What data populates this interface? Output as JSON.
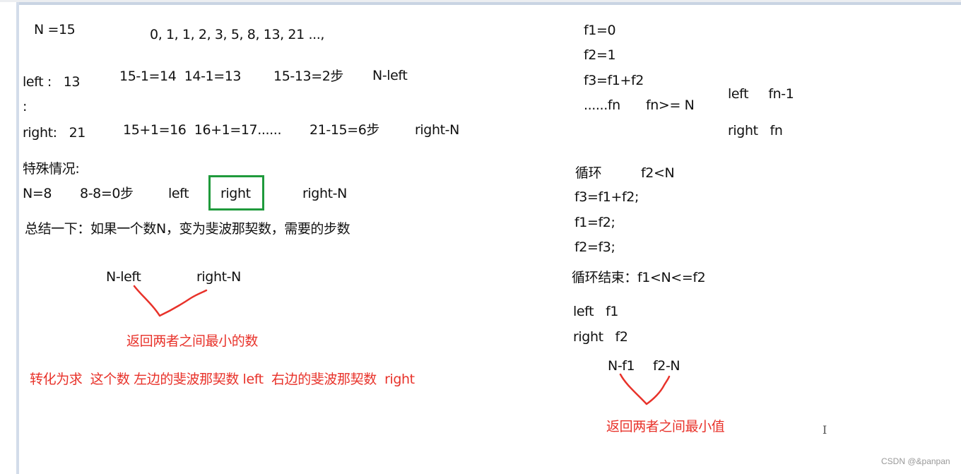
{
  "left_column": {
    "n_value": "N =15",
    "sequence": "0, 1, 1, 2, 3, 5, 8, 13, 21 ...,",
    "left_label": "left :   13",
    "left_steps_a": "15-1=14  14-1=13",
    "left_steps_b": "15-13=2步",
    "left_formula": "N-left",
    "colon": ":",
    "right_label": "right:   21",
    "right_steps_a": "15+1=16  16+1=17......",
    "right_steps_b": "21-15=6步",
    "right_formula": "right-N",
    "special_heading": "特殊情况:",
    "special_n": "N=8",
    "special_steps": "8-8=0步",
    "special_left": "left",
    "special_right_boxed": "right",
    "special_right_formula": "right-N",
    "summary": "总结一下：如果一个数N，变为斐波那契数，需要的步数",
    "diagram_left": "N-left",
    "diagram_right": "right-N",
    "diagram_result": "返回两者之间最小的数",
    "conclusion": "转化为求  这个数 左边的斐波那契数 left  右边的斐波那契数  right"
  },
  "right_column": {
    "f1": "f1=0",
    "f2": "f2=1",
    "f3": "f3=f1+f2",
    "fn": "......fn",
    "fn_cond": "fn>= N",
    "left_fn": "left     fn-1",
    "right_fn": "right   fn",
    "loop_label": "循环",
    "loop_cond": "f2<N",
    "loop_line1": "f3=f1+f2;",
    "loop_line2": "f1=f2;",
    "loop_line3": "f2=f3;",
    "loop_end": "循环结束：f1<N<=f2",
    "left_f1": "left   f1",
    "right_f2": "right   f2",
    "diagram_left": "N-f1",
    "diagram_right": "f2-N",
    "diagram_result": "返回两者之间最小值"
  },
  "colors": {
    "annotation_red": "#e8322a",
    "highlight_green": "#1f9a3c"
  },
  "watermark": "CSDN @&panpan",
  "cursor_glyph": "I"
}
